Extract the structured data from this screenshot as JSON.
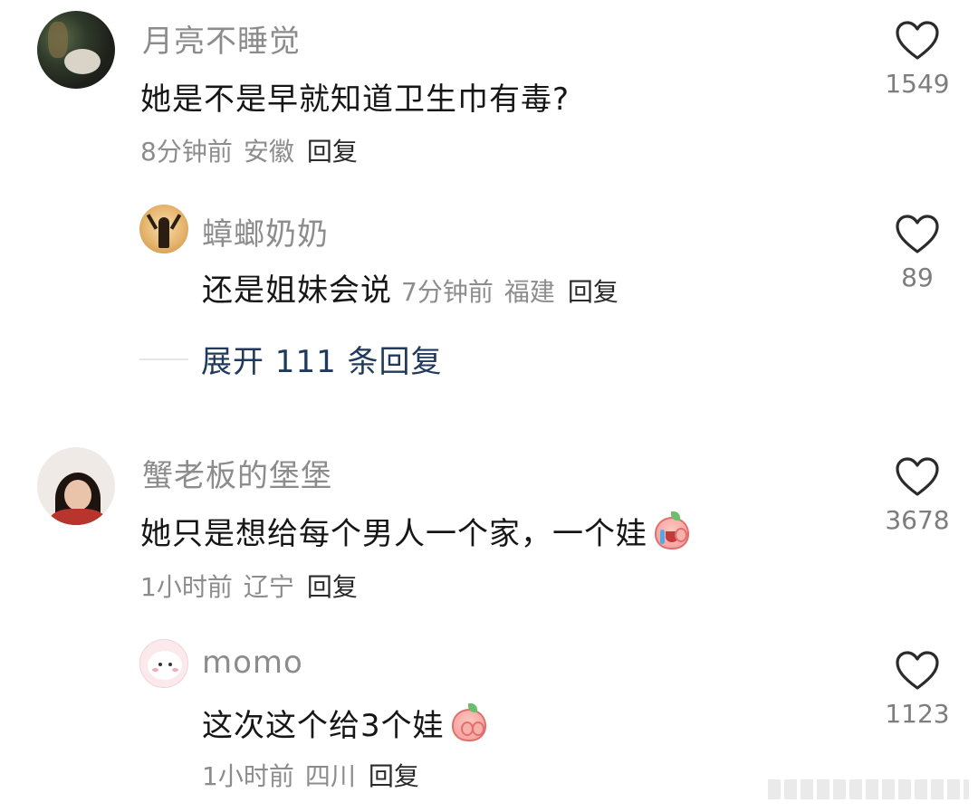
{
  "comments": [
    {
      "username": "月亮不睡觉",
      "text": "她是不是早就知道卫生巾有毒?",
      "time": "8分钟前",
      "location": "安徽",
      "reply_label": "回复",
      "likes": "1549",
      "replies": [
        {
          "username": "蟑螂奶奶",
          "text": "还是姐妹会说",
          "time": "7分钟前",
          "location": "福建",
          "reply_label": "回复",
          "likes": "89"
        }
      ],
      "expand_label": "展开 111 条回复"
    },
    {
      "username": "蟹老板的堡堡",
      "text": "她只是想给每个男人一个家，一个娃",
      "time": "1小时前",
      "location": "辽宁",
      "reply_label": "回复",
      "likes": "3678",
      "replies": [
        {
          "username": "momo",
          "text": "这次这个给3个娃",
          "time": "1小时前",
          "location": "四川",
          "reply_label": "回复",
          "likes": "1123"
        }
      ]
    }
  ],
  "icons": {
    "like": "heart-outline-icon",
    "emoji_cry": "crying-peach-emoji-icon",
    "emoji_shy": "shy-peach-emoji-icon"
  },
  "colors": {
    "username": "#8c8c8c",
    "text": "#161616",
    "expand_link": "#203a5e"
  }
}
